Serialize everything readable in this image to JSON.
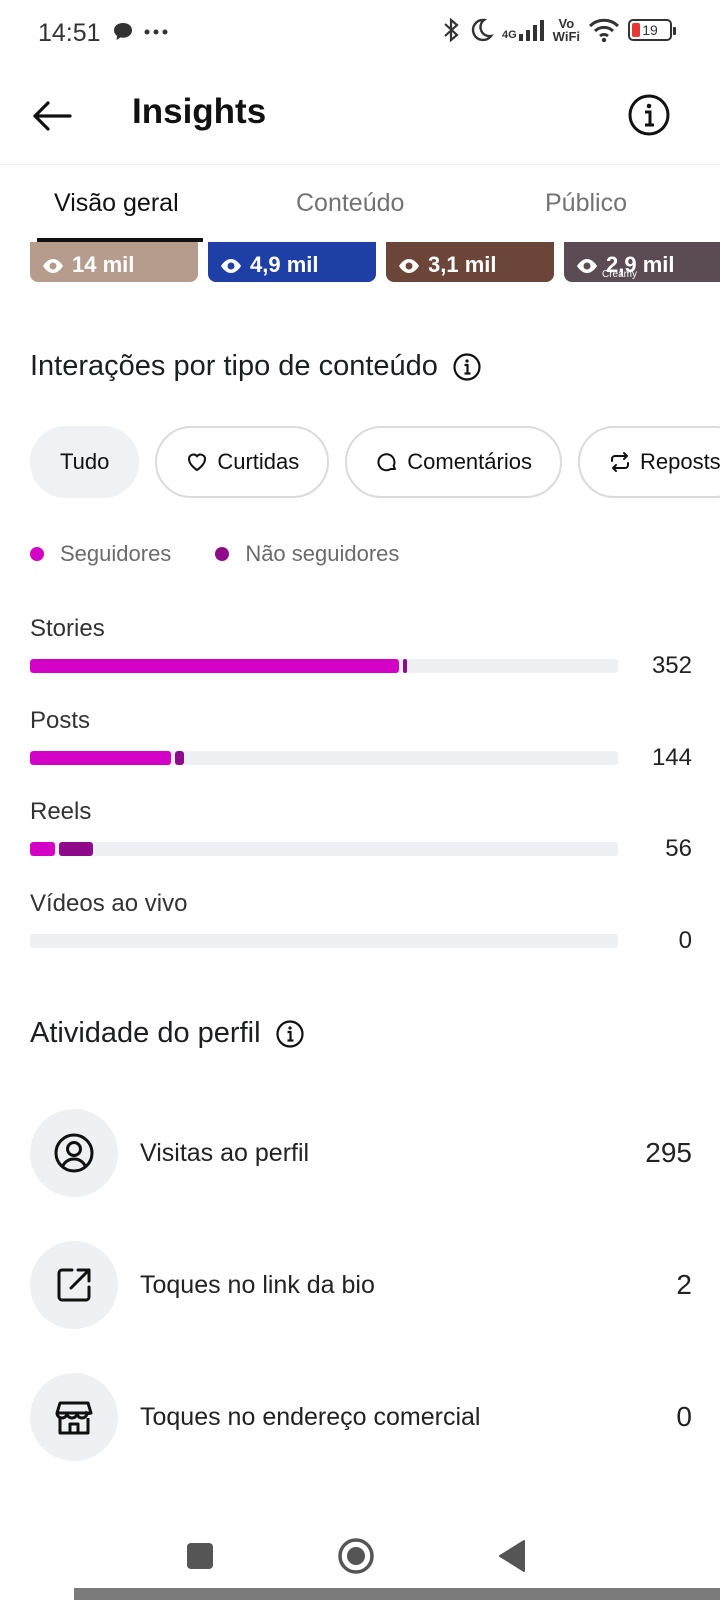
{
  "status_bar": {
    "time": "14:51",
    "network": "4G",
    "volte_top": "Vo",
    "volte_bottom": "WiFi",
    "battery": "19",
    "battery_color": "#e53935"
  },
  "header": {
    "title": "Insights"
  },
  "tabs": [
    {
      "label": "Visão geral",
      "active": true
    },
    {
      "label": "Conteúdo",
      "active": false
    },
    {
      "label": "Público",
      "active": false
    }
  ],
  "thumbnails": [
    {
      "views": "14 mil",
      "bg": "#b59c8d"
    },
    {
      "views": "4,9 mil",
      "bg": "#1e3fa6"
    },
    {
      "views": "3,1 mil",
      "bg": "#6b4638"
    },
    {
      "views": "2,9 mil",
      "bg": "#5b4b55",
      "tag": "Creamy"
    }
  ],
  "interactions": {
    "title": "Interações por tipo de conteúdo",
    "chips": [
      {
        "label": "Tudo",
        "icon": "none",
        "active": true
      },
      {
        "label": "Curtidas",
        "icon": "heart-icon",
        "active": false
      },
      {
        "label": "Comentários",
        "icon": "comment-icon",
        "active": false
      },
      {
        "label": "Reposts",
        "icon": "repost-icon",
        "active": false
      }
    ],
    "legend": [
      {
        "label": "Seguidores",
        "color": "#d300c5"
      },
      {
        "label": "Não seguidores",
        "color": "#8f0a8a"
      }
    ],
    "rows": [
      {
        "label": "Stories",
        "value": "352",
        "followers_fraction": 0.627,
        "nonfollowers_fraction": 0.008
      },
      {
        "label": "Posts",
        "value": "144",
        "followers_fraction": 0.24,
        "nonfollowers_fraction": 0.015
      },
      {
        "label": "Reels",
        "value": "56",
        "followers_fraction": 0.042,
        "nonfollowers_fraction": 0.058
      },
      {
        "label": "Vídeos ao vivo",
        "value": "0",
        "followers_fraction": 0,
        "nonfollowers_fraction": 0
      }
    ]
  },
  "profile_activity": {
    "title": "Atividade do perfil",
    "rows": [
      {
        "label": "Visitas ao perfil",
        "value": "295",
        "icon": "profile-icon"
      },
      {
        "label": "Toques no link da bio",
        "value": "2",
        "icon": "external-link-icon"
      },
      {
        "label": "Toques no endereço comercial",
        "value": "0",
        "icon": "store-icon"
      }
    ]
  }
}
